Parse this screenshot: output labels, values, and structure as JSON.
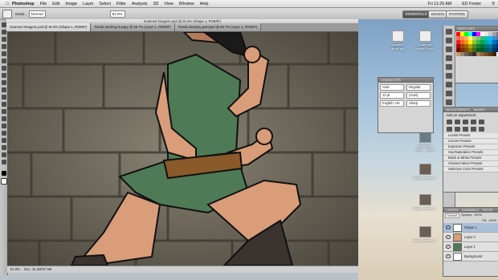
{
  "menubar": {
    "app": "Photoshop",
    "items": [
      "File",
      "Edit",
      "Image",
      "Layer",
      "Select",
      "Filter",
      "Analysis",
      "3D",
      "View",
      "Window",
      "Help"
    ],
    "clock": "Fri 11:25 AM",
    "user": "ED Foster"
  },
  "options": {
    "mode_label": "Mode:",
    "mode_value": "Normal",
    "zoom_value": "81.6%",
    "workspaces": [
      "ESSENTIALS",
      "DESIGN",
      "PAINTING"
    ]
  },
  "document": {
    "title": "Scanned Image21.psd @ 81.6% (Shape 1, RGB/8*)",
    "tabs": [
      "Scanned Image21.psd @ 81.6% (Shape 1, RGB/8*)",
      "Panda seeking Hungry @ 66.7% (Layer 1, RGB/8*)",
      "Panda sleeping gold.psd @ 66.7% (Layer 1, RGB/8*)"
    ],
    "status_zoom": "81.6%",
    "status_doc": "Doc: 15.3M/37.5M"
  },
  "desktop": {
    "icons": [
      "panther ghost.jpg",
      "Scanned Image21.psd",
      "The Earth Scanned 1...",
      "Photo on 2013-... 09:17",
      "crime_scene_4...",
      "crime_scene_4...",
      "crime_scene_4..."
    ]
  },
  "character_panel": {
    "tab": "CHARACTER",
    "font": "Arial",
    "style": "Regular",
    "size": "12 pt",
    "leading": "(Auto)",
    "language": "English: UK",
    "aa": "Sharp"
  },
  "swatches_panel": {
    "tab": "SWATCHES",
    "colors": [
      "#ff0000",
      "#ffff00",
      "#00ff00",
      "#00ffff",
      "#0000ff",
      "#ff00ff",
      "#ffffff",
      "#e6e6e6",
      "#c8c8c8",
      "#a0a0a0",
      "#7a7a7a",
      "#000000",
      "#f26c4f",
      "#f68e55",
      "#fbaf5c",
      "#fff467",
      "#acd372",
      "#7cc576",
      "#3bb878",
      "#1abbb4",
      "#00bff3",
      "#438ccb",
      "#5574b9",
      "#605ca8",
      "#ed1c24",
      "#f26522",
      "#f7941d",
      "#fff200",
      "#8dc63f",
      "#39b54a",
      "#00a651",
      "#00a99d",
      "#00aeef",
      "#0072bc",
      "#0054a6",
      "#2e3192",
      "#9e0b0f",
      "#a0410d",
      "#a36209",
      "#aba000",
      "#598527",
      "#1a7b30",
      "#007236",
      "#00746b",
      "#0076a3",
      "#004b80",
      "#003471",
      "#1b1464",
      "#790000",
      "#7b2e00",
      "#7d4900",
      "#827b00",
      "#406618",
      "#005e20",
      "#005826",
      "#005952",
      "#005b7f",
      "#003663",
      "#002157",
      "#0d004c",
      "#c69c6d",
      "#998675",
      "#736357",
      "#534741",
      "#362f2d",
      "#a67c52",
      "#8c6239",
      "#754c24",
      "#603913",
      "#42210b",
      "#ffffff",
      "#999999"
    ]
  },
  "adjustments_panel": {
    "tabs": [
      "ADJUSTMENTS",
      "MASKS"
    ],
    "title": "Add an adjustment",
    "presets": [
      "Levels Presets",
      "Curves Presets",
      "Exposure Presets",
      "Hue/Saturation Presets",
      "Black & White Presets",
      "Channel Mixer Presets",
      "Selective Color Presets"
    ]
  },
  "layers_panel": {
    "tabs": [
      "LAYERS",
      "CHANNELS",
      "PATHS"
    ],
    "blend": "Normal",
    "opacity_label": "Opacity:",
    "opacity": "100%",
    "fill_label": "Fill:",
    "fill": "100%",
    "layers": [
      "Shape 1",
      "Layer 2",
      "Layer 1",
      "Background"
    ]
  }
}
